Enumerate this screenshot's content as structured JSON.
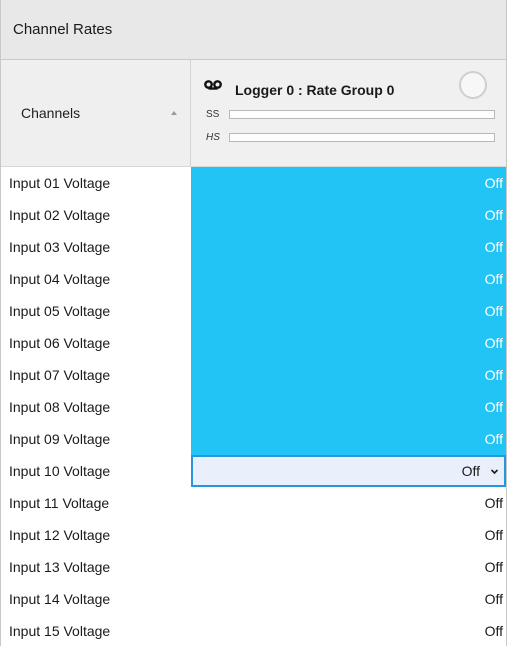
{
  "panel": {
    "title": "Channel Rates"
  },
  "header": {
    "channels_label": "Channels",
    "logger_title": "Logger 0 : Rate Group 0",
    "ss_label": "SS",
    "hs_label": "HS",
    "sort_direction": "ascending",
    "logger_icon": "voicemail-icon"
  },
  "colors": {
    "selected_cell": "#22c3f5",
    "editing_border": "#2596e0",
    "editing_background": "#e9f0fb"
  },
  "rows": [
    {
      "name": "Input 01 Voltage",
      "rate": "Off",
      "state": "selected"
    },
    {
      "name": "Input 02 Voltage",
      "rate": "Off",
      "state": "selected"
    },
    {
      "name": "Input 03 Voltage",
      "rate": "Off",
      "state": "selected"
    },
    {
      "name": "Input 04 Voltage",
      "rate": "Off",
      "state": "selected"
    },
    {
      "name": "Input 05 Voltage",
      "rate": "Off",
      "state": "selected"
    },
    {
      "name": "Input 06 Voltage",
      "rate": "Off",
      "state": "selected"
    },
    {
      "name": "Input 07 Voltage",
      "rate": "Off",
      "state": "selected"
    },
    {
      "name": "Input 08 Voltage",
      "rate": "Off",
      "state": "selected"
    },
    {
      "name": "Input 09 Voltage",
      "rate": "Off",
      "state": "selected"
    },
    {
      "name": "Input 10 Voltage",
      "rate": "Off",
      "state": "editing"
    },
    {
      "name": "Input 11 Voltage",
      "rate": "Off",
      "state": "normal"
    },
    {
      "name": "Input 12 Voltage",
      "rate": "Off",
      "state": "normal"
    },
    {
      "name": "Input 13 Voltage",
      "rate": "Off",
      "state": "normal"
    },
    {
      "name": "Input 14 Voltage",
      "rate": "Off",
      "state": "normal"
    },
    {
      "name": "Input 15 Voltage",
      "rate": "Off",
      "state": "normal"
    }
  ]
}
